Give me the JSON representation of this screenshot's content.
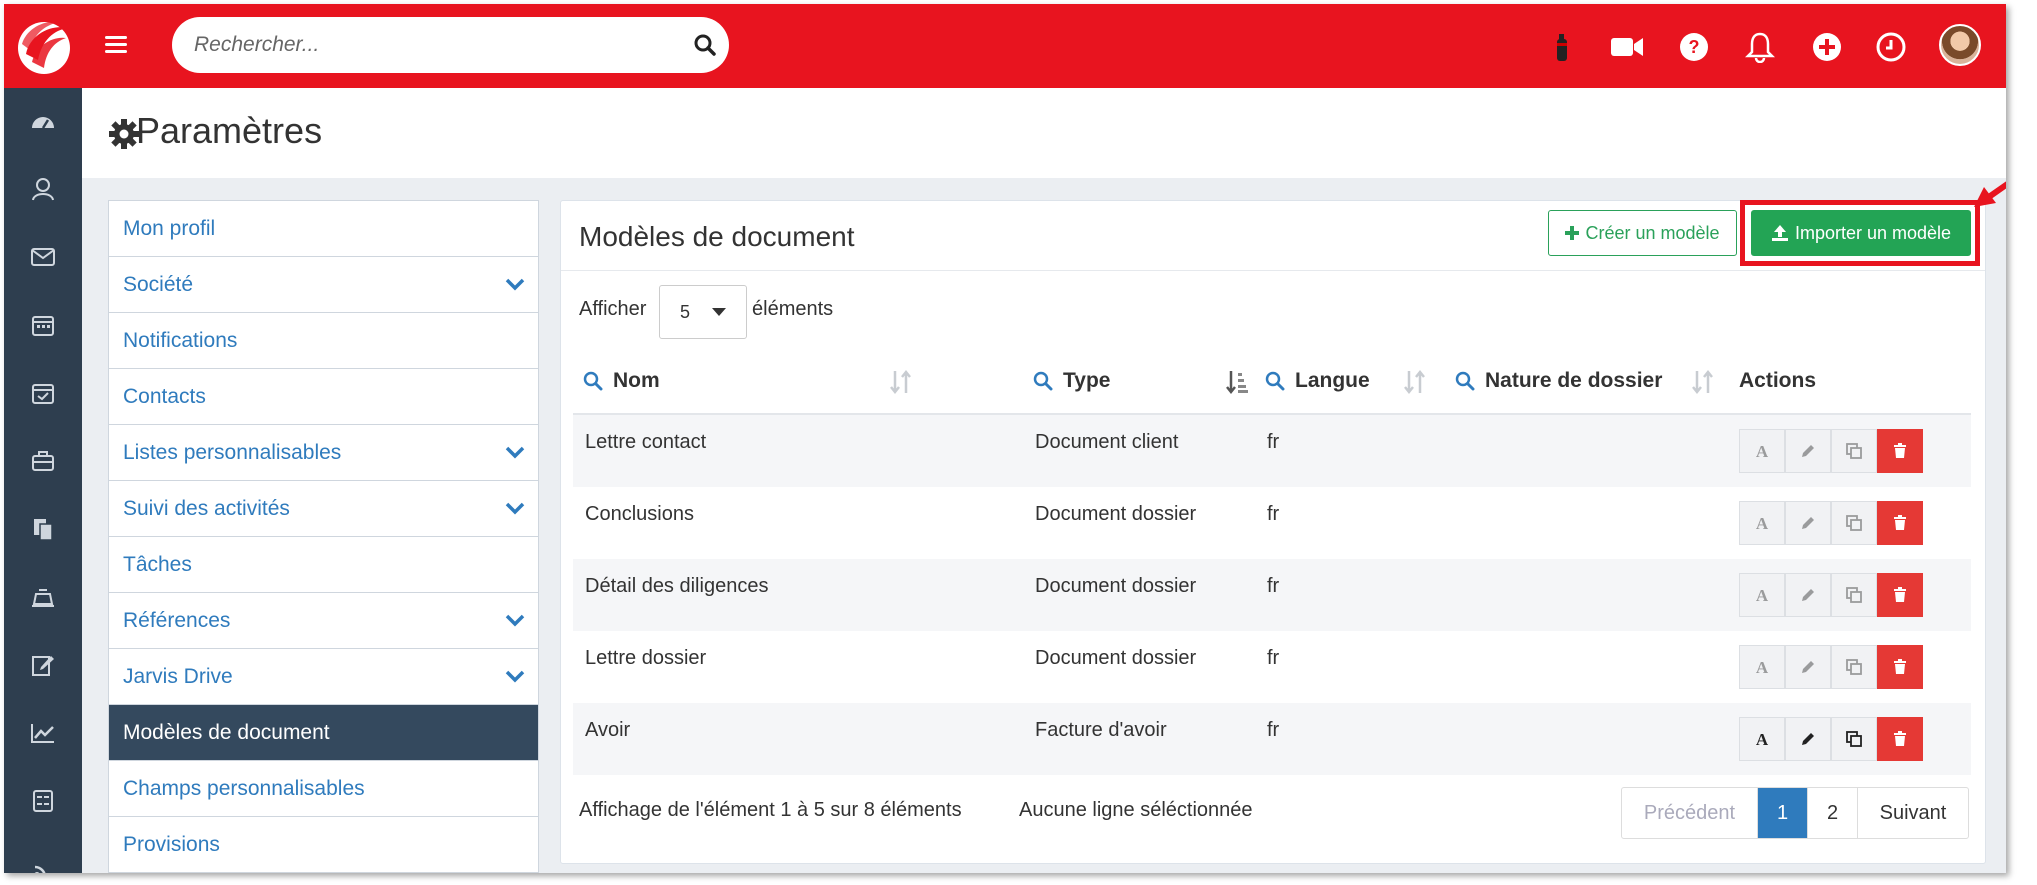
{
  "topbar": {
    "search_placeholder": "Rechercher...",
    "icons": [
      "fire-extinguisher-icon",
      "video-camera-icon",
      "help-icon",
      "bell-icon",
      "plus-circle-icon",
      "clock-icon"
    ]
  },
  "sidebar": {
    "icons": [
      "dashboard-icon",
      "contacts-icon",
      "mail-icon",
      "calendar-icon",
      "calendar-check-icon",
      "briefcase-icon",
      "documents-icon",
      "billing-icon",
      "edit-icon",
      "chart-icon",
      "calculator-icon",
      "rss-icon"
    ]
  },
  "page": {
    "title": "Paramètres"
  },
  "menu": {
    "items": [
      {
        "label": "Mon profil",
        "chevron": false
      },
      {
        "label": "Société",
        "chevron": true
      },
      {
        "label": "Notifications",
        "chevron": false
      },
      {
        "label": "Contacts",
        "chevron": false
      },
      {
        "label": "Listes personnalisables",
        "chevron": true
      },
      {
        "label": "Suivi des activités",
        "chevron": true
      },
      {
        "label": "Tâches",
        "chevron": false
      },
      {
        "label": "Références",
        "chevron": true
      },
      {
        "label": "Jarvis Drive",
        "chevron": true
      },
      {
        "label": "Modèles de document",
        "chevron": false,
        "active": true
      },
      {
        "label": "Champs personnalisables",
        "chevron": false
      },
      {
        "label": "Provisions",
        "chevron": false
      }
    ]
  },
  "panel": {
    "title": "Modèles de document",
    "create_label": "Créer un modèle",
    "import_label": "Importer un modèle",
    "show_label": "Afficher",
    "page_size": "5",
    "elements_label": "éléments",
    "columns": {
      "nom": "Nom",
      "type": "Type",
      "langue": "Langue",
      "nature": "Nature de dossier",
      "actions": "Actions"
    },
    "rows": [
      {
        "nom": "Lettre contact",
        "type": "Document client",
        "langue": "fr",
        "nature": ""
      },
      {
        "nom": "Conclusions",
        "type": "Document dossier",
        "langue": "fr",
        "nature": ""
      },
      {
        "nom": "Détail des diligences",
        "type": "Document dossier",
        "langue": "fr",
        "nature": ""
      },
      {
        "nom": "Lettre dossier",
        "type": "Document dossier",
        "langue": "fr",
        "nature": ""
      },
      {
        "nom": "Avoir",
        "type": "Facture d'avoir",
        "langue": "fr",
        "nature": ""
      }
    ],
    "footer_info": "Affichage de l'élément 1 à 5 sur 8 éléments",
    "footer_selection": "Aucune ligne séléctionnée",
    "pager": {
      "prev": "Précédent",
      "pages": [
        "1",
        "2"
      ],
      "current": "1",
      "next": "Suivant"
    }
  },
  "colors": {
    "brand_red": "#e8141f",
    "sidebar": "#2e3e4f",
    "link_blue": "#2f7bbd",
    "success_green": "#23a455",
    "danger_red": "#e53935"
  }
}
